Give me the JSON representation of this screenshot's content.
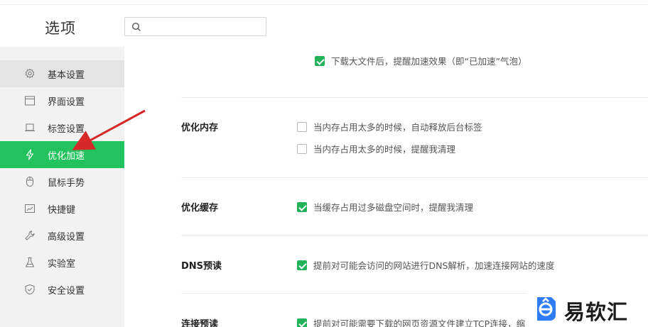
{
  "header": {
    "title": "选项",
    "search": {
      "value": "",
      "placeholder": ""
    }
  },
  "sidebar": {
    "items": [
      {
        "label": "基本设置",
        "icon": "gear-icon"
      },
      {
        "label": "界面设置",
        "icon": "window-icon"
      },
      {
        "label": "标签设置",
        "icon": "tab-icon"
      },
      {
        "label": "优化加速",
        "icon": "lightning-icon",
        "active": true
      },
      {
        "label": "鼠标手势",
        "icon": "mouse-icon"
      },
      {
        "label": "快捷键",
        "icon": "keyboard-icon"
      },
      {
        "label": "高级设置",
        "icon": "wrench-icon"
      },
      {
        "label": "实验室",
        "icon": "flask-icon"
      },
      {
        "label": "安全设置",
        "icon": "shield-icon"
      }
    ]
  },
  "main": {
    "top_option": {
      "label": "下载大文件后，提醒加速效果（即“已加速”气泡）",
      "checked": true
    },
    "sections": [
      {
        "title": "优化内存",
        "options": [
          {
            "label": "当内存占用太多的时候，自动释放后台标签",
            "checked": false
          },
          {
            "label": "当内存占用太多的时候，提醒我清理",
            "checked": false
          }
        ]
      },
      {
        "title": "优化缓存",
        "options": [
          {
            "label": "当缓存占用过多磁盘空间时，提醒我清理",
            "checked": true
          }
        ]
      },
      {
        "title": "DNS预读",
        "options": [
          {
            "label": "提前对可能会访问的网站进行DNS解析，加速连接网站的速度",
            "checked": true
          }
        ]
      },
      {
        "title": "连接预读",
        "options": [
          {
            "label": "提前对可能需要下载的网页资源文件建立TCP连接，缩",
            "checked": true
          }
        ]
      }
    ]
  },
  "watermark": {
    "text": "易软汇"
  },
  "colors": {
    "accent": "#22c35e",
    "checkbox": "#22b35a",
    "arrow": "#d62828"
  }
}
